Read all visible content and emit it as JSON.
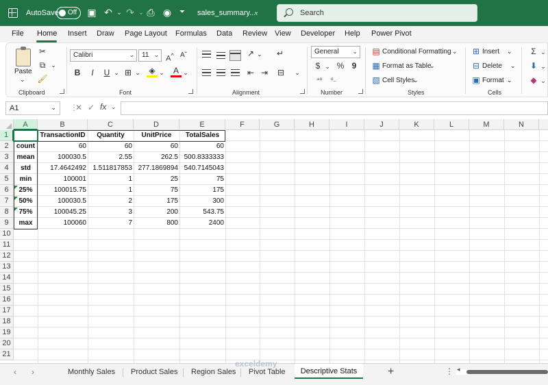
{
  "titlebar": {
    "autosave_label": "AutoSave",
    "toggle_state": "Off",
    "filename": "sales_summary....",
    "search_placeholder": "Search"
  },
  "menu": {
    "tabs": [
      "File",
      "Home",
      "Insert",
      "Draw",
      "Page Layout",
      "Formulas",
      "Data",
      "Review",
      "View",
      "Developer",
      "Help",
      "Power Pivot"
    ],
    "active": "Home"
  },
  "ribbon": {
    "clipboard": {
      "label": "Clipboard",
      "paste": "Paste"
    },
    "font": {
      "label": "Font",
      "name": "Calibri",
      "size": "11"
    },
    "alignment": {
      "label": "Alignment"
    },
    "number": {
      "label": "Number",
      "format": "General"
    },
    "styles": {
      "label": "Styles",
      "conditional": "Conditional Formatting",
      "format_table": "Format as Table",
      "cell_styles": "Cell Styles"
    },
    "cells": {
      "label": "Cells",
      "insert": "Insert",
      "delete": "Delete",
      "format": "Format"
    }
  },
  "formula_bar": {
    "name_box": "A1",
    "fx": "fx",
    "value": ""
  },
  "grid": {
    "columns": [
      "A",
      "B",
      "C",
      "D",
      "E",
      "F",
      "G",
      "H",
      "I",
      "J",
      "K",
      "L",
      "M",
      "N"
    ],
    "rows": [
      "1",
      "2",
      "3",
      "4",
      "5",
      "6",
      "7",
      "8",
      "9",
      "10",
      "11",
      "12",
      "13",
      "14",
      "15",
      "16",
      "17",
      "18",
      "19",
      "20",
      "21"
    ],
    "headers": [
      "",
      "TransactionID",
      "Quantity",
      "UnitPrice",
      "TotalSales"
    ],
    "data": [
      [
        "count",
        "60",
        "60",
        "60",
        "60"
      ],
      [
        "mean",
        "100030.5",
        "2.55",
        "262.5",
        "500.8333333"
      ],
      [
        "std",
        "17.4642492",
        "1.511817853",
        "277.1869894",
        "540.7145043"
      ],
      [
        "min",
        "100001",
        "1",
        "25",
        "75"
      ],
      [
        "25%",
        "100015.75",
        "1",
        "75",
        "175"
      ],
      [
        "50%",
        "100030.5",
        "2",
        "175",
        "300"
      ],
      [
        "75%",
        "100045.25",
        "3",
        "200",
        "543.75"
      ],
      [
        "max",
        "100060",
        "7",
        "800",
        "2400"
      ]
    ],
    "active_cell": "A1"
  },
  "sheets": {
    "tabs": [
      "Monthly Sales",
      "Product Sales",
      "Region Sales",
      "Pivot Table",
      "Descriptive Stats"
    ],
    "active": "Descriptive Stats"
  },
  "watermark": "exceldemy",
  "colors": {
    "accent": "#217346",
    "selected_header": "#d3f0e0"
  }
}
